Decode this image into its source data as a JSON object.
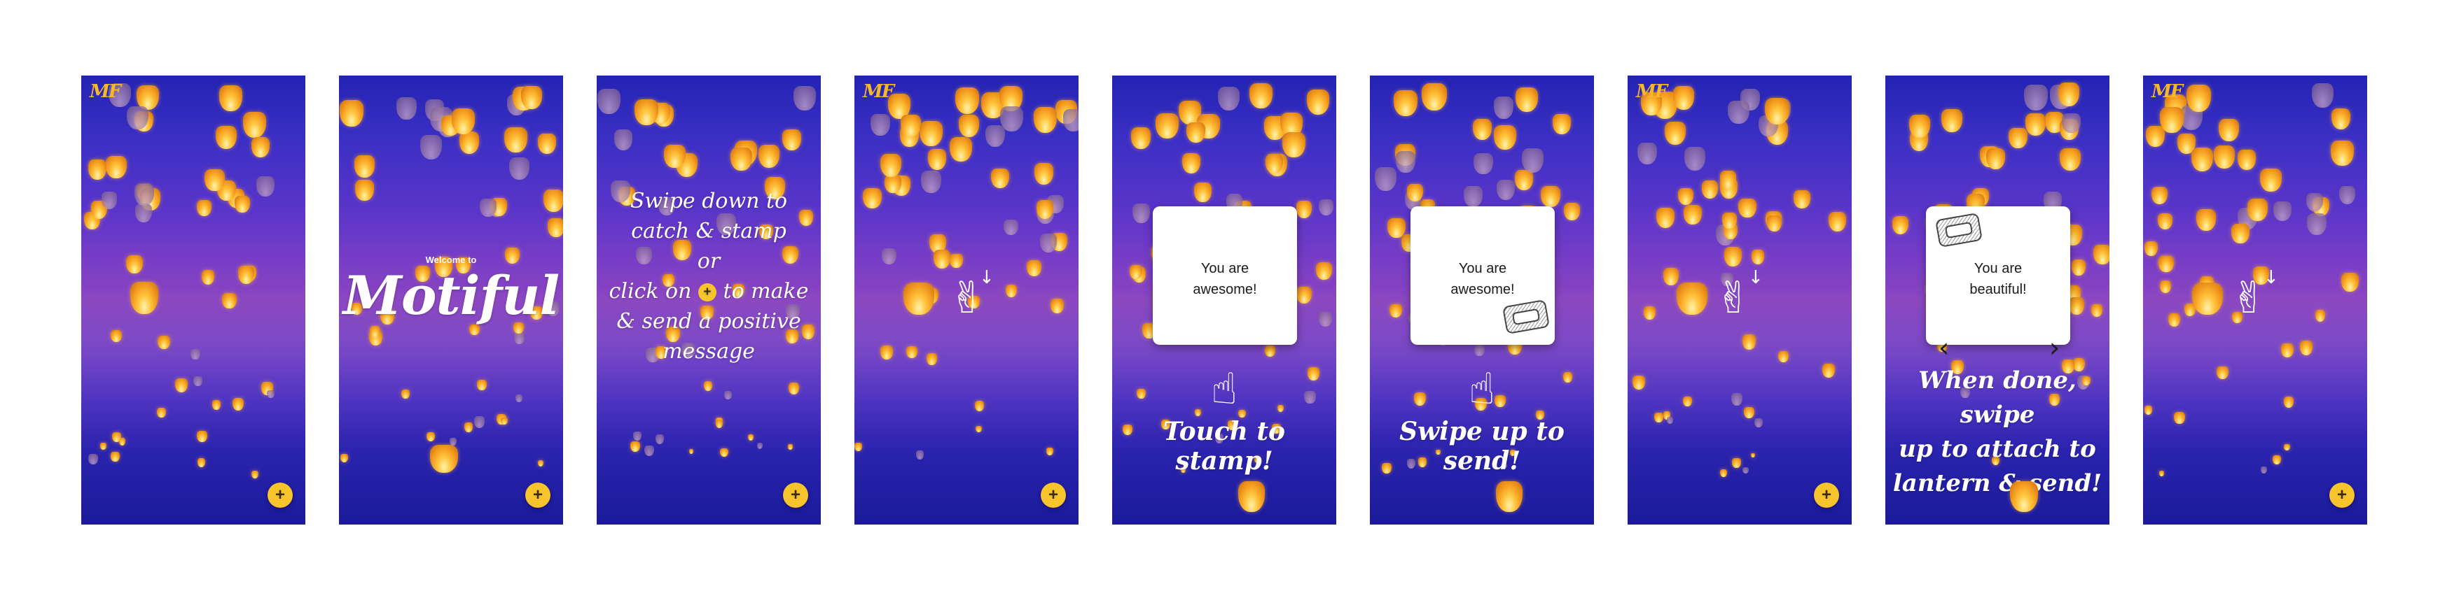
{
  "app": {
    "logo_text": "MF",
    "add_label": "+"
  },
  "colors": {
    "sky_top": "#2323b4",
    "sky_mid": "#8a45c0",
    "sky_bottom": "#1a1a9a",
    "lantern_glow": "#ffc53d",
    "fab": "#f7c52b",
    "card": "#ffffff"
  },
  "screens": [
    {
      "name": "home"
    },
    {
      "name": "welcome",
      "welcome_small": "Welcome to",
      "app_name": "Motiful"
    },
    {
      "name": "instructions",
      "line1": "Swipe down to",
      "line2": "catch & stamp",
      "line3": "or",
      "line4_before": "click on",
      "line4_after": "to make",
      "line5": "& send a positive",
      "line6": "message"
    },
    {
      "name": "catch-hint",
      "icon": "swipe-down-hand-icon"
    },
    {
      "name": "touch-to-stamp",
      "message_line1": "You are",
      "message_line2": "awesome!",
      "caption": "Touch to stamp!",
      "icon": "tap-hand-icon"
    },
    {
      "name": "swipe-up-to-send",
      "message_line1": "You are",
      "message_line2": "awesome!",
      "caption": "Swipe up to send!",
      "icon": "tap-hand-icon",
      "stamp": "stamp-icon"
    },
    {
      "name": "catch-hint-2",
      "icon": "swipe-down-hand-icon"
    },
    {
      "name": "compose",
      "message_line1": "You are",
      "message_line2": "beautiful!",
      "prev_label": "‹",
      "next_label": "›",
      "caption_line1": "When done, swipe",
      "caption_line2": "up to attach to",
      "caption_line3": "lantern & send!"
    },
    {
      "name": "catch-hint-3",
      "icon": "swipe-down-hand-icon"
    }
  ],
  "hand_glyphs": {
    "swipe": "✌",
    "tap": "☝",
    "down_arrow": "↓"
  }
}
